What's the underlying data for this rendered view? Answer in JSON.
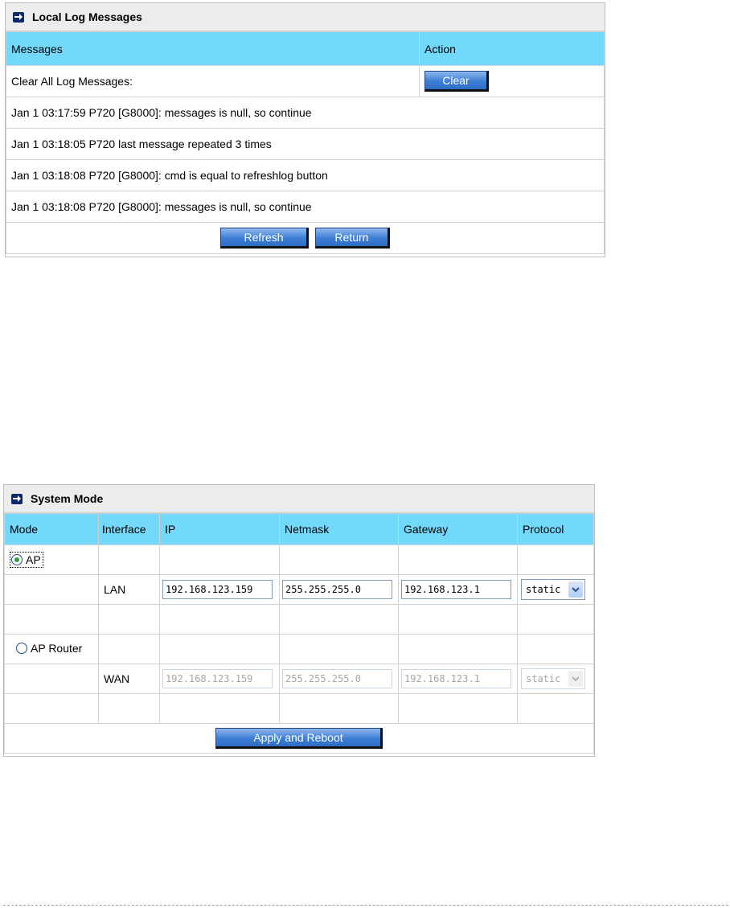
{
  "log_panel": {
    "title": "Local Log Messages",
    "headers": {
      "messages": "Messages",
      "action": "Action"
    },
    "clear_row_label": "Clear All Log Messages:",
    "clear_button": "Clear",
    "entries": [
      "Jan 1 03:17:59 P720 [G8000]: messages is null, so continue",
      "Jan 1 03:18:05 P720 last message repeated 3 times",
      "Jan 1 03:18:08 P720 [G8000]: cmd is equal to refreshlog button",
      "Jan 1 03:18:08 P720 [G8000]: messages is null, so continue"
    ],
    "refresh_button": "Refresh",
    "return_button": "Return"
  },
  "mode_panel": {
    "title": "System Mode",
    "headers": {
      "mode": "Mode",
      "interface": "Interface",
      "ip": "IP",
      "netmask": "Netmask",
      "gateway": "Gateway",
      "protocol": "Protocol"
    },
    "ap": {
      "label": "AP",
      "selected": true,
      "interface": "LAN",
      "ip": "192.168.123.159",
      "netmask": "255.255.255.0",
      "gateway": "192.168.123.1",
      "protocol": "static"
    },
    "ap_router": {
      "label": "AP Router",
      "selected": false,
      "interface": "WAN",
      "ip": "192.168.123.159",
      "netmask": "255.255.255.0",
      "gateway": "192.168.123.1",
      "protocol": "static"
    },
    "apply_button": "Apply and Reboot"
  },
  "colors": {
    "header_bg": "#73d9fb",
    "title_bg": "#ececec",
    "button": "#3d7fd6",
    "radio_dot": "#2ea043"
  },
  "icons": {
    "panel_title": "arrow-right-icon",
    "select": "chevron-down-icon"
  }
}
